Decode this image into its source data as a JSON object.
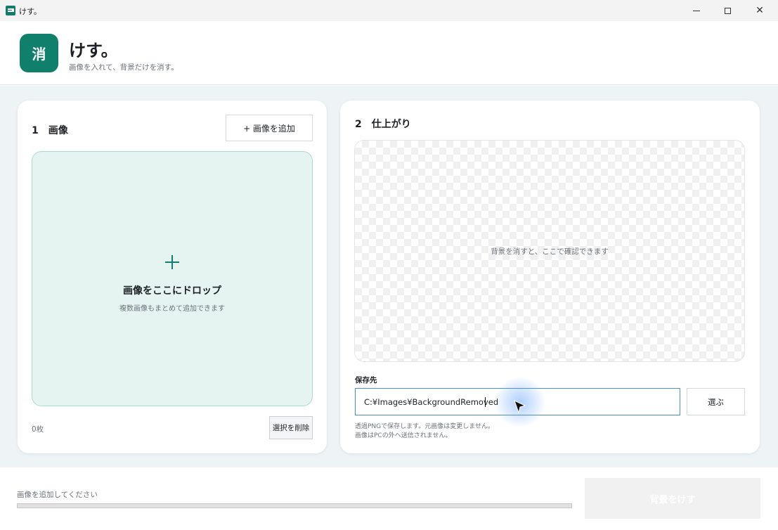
{
  "window": {
    "title": "けす。",
    "close_glyph": "✕"
  },
  "header": {
    "logo_text": "消",
    "app_name": "けす。",
    "subtitle": "画像を入れて、背景だけを消す。"
  },
  "input_section": {
    "number": "1",
    "title": "画像",
    "add_button_label": "+ 画像を追加",
    "dropzone_title": "画像をここにドロップ",
    "dropzone_subtitle": "複数画像もまとめて追加できます",
    "count_text": "0枚",
    "delete_button_label": "選択を削除"
  },
  "output_section": {
    "number": "2",
    "title": "仕上がり",
    "preview_placeholder": "背景を消すと、ここで確認できます",
    "save_label": "保存先",
    "save_path": "C:¥Images¥BackgroundRemoved",
    "choose_button_label": "選ぶ",
    "hint_line1": "透過PNGで保存します。元画像は変更しません。",
    "hint_line2": "画像はPCの外へ送信されません。"
  },
  "footer": {
    "status_text": "画像を追加してください",
    "progress": 0,
    "run_button_label": "背景をけす",
    "run_button_enabled": false
  },
  "colors": {
    "accent": "#10806d",
    "dropzone_bg": "#e6f4f1",
    "main_bg": "#eef3f6"
  }
}
